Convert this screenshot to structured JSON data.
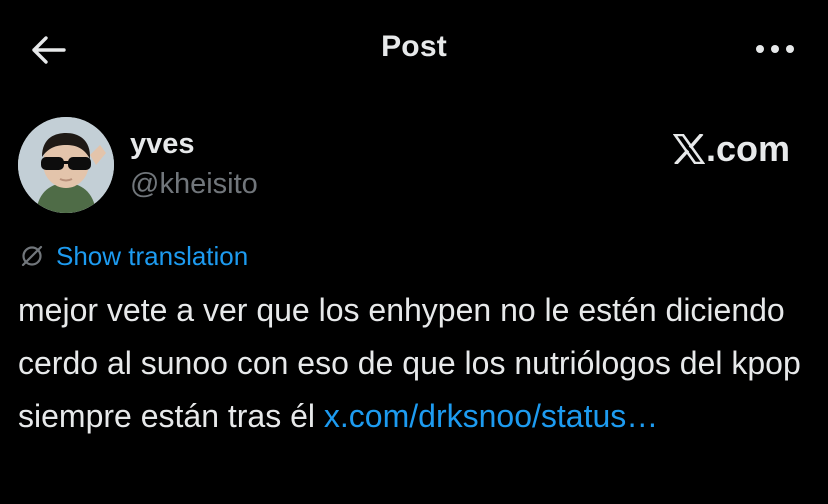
{
  "header": {
    "title": "Post"
  },
  "author": {
    "display_name": "yves",
    "handle": "@kheisito",
    "source": ".com"
  },
  "translation": {
    "label": "Show translation"
  },
  "post": {
    "text": "mejor vete a ver que los enhypen no le estén diciendo cerdo al sunoo con eso de que los nutriólogos del kpop siempre están tras él ",
    "link_text": "x.com/drksnoo/status…"
  },
  "colors": {
    "background": "#000000",
    "text": "#e7e9ea",
    "secondary": "#71767b",
    "link": "#1d9bf0"
  },
  "icons": {
    "back": "arrow-left-icon",
    "more": "more-dots-icon",
    "brand": "x-logo-icon",
    "translate": "translate-icon"
  }
}
